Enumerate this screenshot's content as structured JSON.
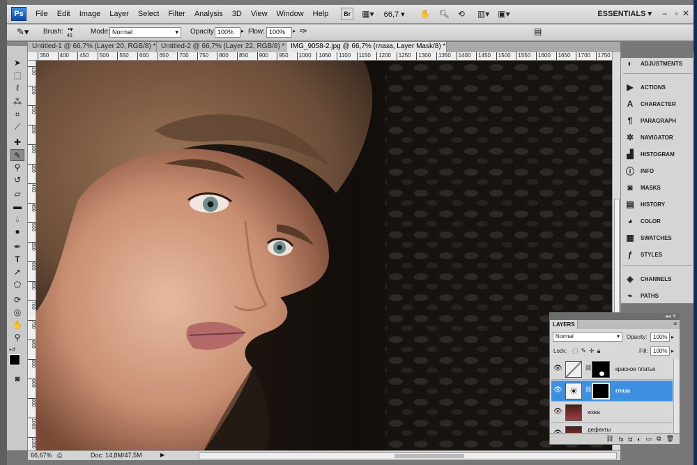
{
  "app": {
    "logo": "Ps"
  },
  "menu": [
    "File",
    "Edit",
    "Image",
    "Layer",
    "Select",
    "Filter",
    "Analysis",
    "3D",
    "View",
    "Window",
    "Help"
  ],
  "menubar": {
    "bridge_label": "Br",
    "zoom": "66,7",
    "workspace": "ESSENTIALS",
    "icons": [
      "bridge-icon",
      "mini-bridge-icon",
      "hand-icon",
      "zoom-icon",
      "rotate-view-icon",
      "arrange-documents-icon",
      "screen-mode-icon"
    ]
  },
  "options": {
    "brush_label": "Brush:",
    "brush_size": "45",
    "mode_label": "Mode:",
    "mode_value": "Normal",
    "opacity_label": "Opacity:",
    "opacity_value": "100%",
    "flow_label": "Flow:",
    "flow_value": "100%"
  },
  "tabs": [
    {
      "label": "Untitled-1 @ 66,7% (Layer 20, RGB/8) *",
      "active": false
    },
    {
      "label": "Untitled-2 @ 66,7% (Layer 22, RGB/8) *",
      "active": false
    },
    {
      "label": "IMG_9058-2.jpg @ 66,7% (глаза, Layer Mask/8) *",
      "active": true
    }
  ],
  "ruler_top": [
    "350",
    "400",
    "450",
    "500",
    "550",
    "600",
    "650",
    "700",
    "750",
    "800",
    "850",
    "900",
    "950",
    "1000",
    "1050",
    "1100",
    "1150",
    "1200",
    "1250",
    "1300",
    "1350",
    "1400",
    "1450",
    "1500",
    "1550",
    "1600",
    "1650",
    "1700",
    "1750"
  ],
  "ruler_left": [
    "100",
    "150",
    "200",
    "250",
    "300",
    "350",
    "400",
    "450",
    "500",
    "550",
    "600",
    "650",
    "700",
    "750",
    "800",
    "850",
    "900",
    "950",
    "1000",
    "1050",
    "1100"
  ],
  "tools": [
    "move-tool-icon",
    "marquee-tool-icon",
    "lasso-tool-icon",
    "quick-select-tool-icon",
    "crop-tool-icon",
    "eyedropper-tool-icon",
    "spot-healing-tool-icon",
    "brush-tool-icon",
    "clone-stamp-tool-icon",
    "history-brush-tool-icon",
    "eraser-tool-icon",
    "gradient-tool-icon",
    "blur-tool-icon",
    "dodge-tool-icon",
    "pen-tool-icon",
    "type-tool-icon",
    "path-select-tool-icon",
    "shape-tool-icon",
    "3d-rotate-tool-icon",
    "3d-orbit-tool-icon",
    "hand-tool-icon",
    "zoom-tool-icon"
  ],
  "dock": {
    "groups": [
      [
        "ADJUSTMENTS"
      ],
      [
        "ACTIONS",
        "CHARACTER",
        "PARAGRAPH",
        "NAVIGATOR",
        "HISTOGRAM",
        "INFO",
        "MASKS",
        "HISTORY",
        "COLOR",
        "SWATCHES",
        "STYLES"
      ],
      [
        "CHANNELS",
        "PATHS"
      ]
    ]
  },
  "layers_panel": {
    "tab": "LAYERS",
    "blend_mode": "Normal",
    "opacity_label": "Opacity:",
    "opacity_value": "100%",
    "lock_label": "Lock:",
    "fill_label": "Fill:",
    "fill_value": "100%",
    "layers": [
      {
        "name": "красное платье",
        "active": false
      },
      {
        "name": "глаза",
        "active": true
      },
      {
        "name": "кожа",
        "active": false
      },
      {
        "name": "дефекты",
        "active": false
      }
    ],
    "footer_icons": [
      "link-layers-icon",
      "fx-icon",
      "add-mask-icon",
      "adjustment-layer-icon",
      "group-icon",
      "new-layer-icon",
      "trash-icon"
    ]
  },
  "status": {
    "zoom": "66,67%",
    "doc": "Doc: 14,8M/47,5M"
  }
}
